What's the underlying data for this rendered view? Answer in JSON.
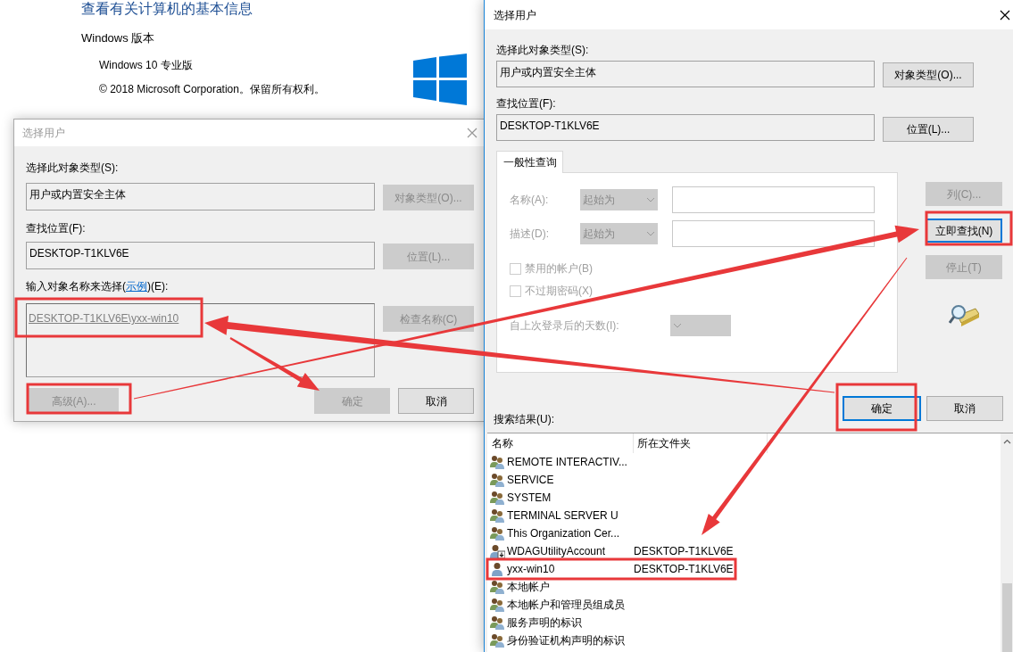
{
  "system_info": {
    "heading": "查看有关计算机的基本信息",
    "section": "Windows 版本",
    "edition": "Windows 10 专业版",
    "copyright": "© 2018 Microsoft Corporation。保留所有权利。"
  },
  "back_dialog": {
    "title": "选择用户",
    "active": false,
    "object_type_label": "选择此对象类型(S):",
    "object_type": "用户或内置安全主体",
    "object_type_button": {
      "label": "对象类型(O)...",
      "disabled": true
    },
    "location_label": "查找位置(F):",
    "location": "DESKTOP-T1KLV6E",
    "location_button": {
      "label": "位置(L)...",
      "disabled": true
    },
    "names_label": {
      "before": "输入对象名称来选择(",
      "link": "示例",
      "after": ")(E):"
    },
    "names_value": "DESKTOP-T1KLV6E\\yxx-win10",
    "check_names_button": {
      "label": "检查名称(C)",
      "disabled": true
    },
    "buttons": [
      {
        "label": "高级(A)...",
        "disabled": true
      },
      {
        "label": "确定",
        "disabled": true
      },
      {
        "label": "取消",
        "disabled": false
      }
    ]
  },
  "front_dialog": {
    "title": "选择用户",
    "active": true,
    "object_type_label": "选择此对象类型(S):",
    "object_type": "用户或内置安全主体",
    "object_type_button": {
      "label": "对象类型(O)...",
      "disabled": false
    },
    "location_label": "查找位置(F):",
    "location": "DESKTOP-T1KLV6E",
    "location_button": {
      "label": "位置(L)...",
      "disabled": false
    },
    "tab": {
      "label": "一般性查询",
      "selected": true
    },
    "query": {
      "name_label": "名称(A):",
      "name_mode": "起始为",
      "description_label": "描述(D):",
      "description_mode": "起始为",
      "disabled": true,
      "checkboxes": [
        {
          "label": "禁用的帐户(B)",
          "checked": false
        },
        {
          "label": "不过期密码(X)",
          "checked": false
        }
      ],
      "days_label": "自上次登录后的天数(I):"
    },
    "side_buttons": [
      {
        "label": "列(C)...",
        "disabled": true,
        "focused": false
      },
      {
        "label": "立即查找(N)",
        "disabled": false,
        "focused": true
      },
      {
        "label": "停止(T)",
        "disabled": true,
        "focused": false
      }
    ],
    "buttons": [
      {
        "label": "确定",
        "disabled": false,
        "focused": true
      },
      {
        "label": "取消",
        "disabled": false,
        "focused": false
      }
    ],
    "results_label": "搜索结果(U):",
    "results": {
      "columns": [
        "名称",
        "所在文件夹"
      ],
      "rows": [
        {
          "kind": "group",
          "name": "REMOTE INTERACTIV..."
        },
        {
          "kind": "group",
          "name": "SERVICE"
        },
        {
          "kind": "group",
          "name": "SYSTEM"
        },
        {
          "kind": "group",
          "name": "TERMINAL SERVER U"
        },
        {
          "kind": "group",
          "name": "This Organization Cer..."
        },
        {
          "kind": "managed_user",
          "name": "WDAGUtilityAccount",
          "folder": "DESKTOP-T1KLV6E"
        },
        {
          "kind": "user",
          "name": "yxx-win10",
          "folder": "DESKTOP-T1KLV6E"
        },
        {
          "kind": "group",
          "name": "本地帐户"
        },
        {
          "kind": "group",
          "name": "本地帐户和管理员组成员"
        },
        {
          "kind": "group",
          "name": "服务声明的标识"
        },
        {
          "kind": "group",
          "name": "身份验证机构声明的标识"
        }
      ]
    }
  }
}
